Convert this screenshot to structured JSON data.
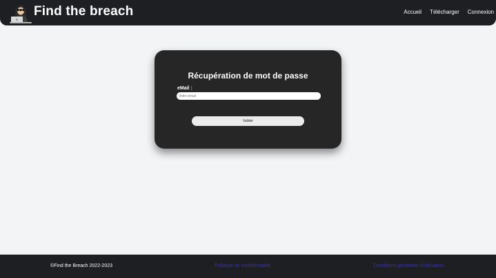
{
  "header": {
    "logo_icon": "hacker-with-laptop-icon",
    "site_title": "Find the breach",
    "nav": {
      "home": "Accueil",
      "download": "Télécharger",
      "login": "Connexion"
    }
  },
  "form": {
    "title": "Récupération de mot de passe",
    "email_label": "eMail :",
    "email_placeholder": "Votre email",
    "email_value": "",
    "submit_label": "Valider"
  },
  "footer": {
    "copyright": "©Find the Breach 2022-2023",
    "privacy_link": "Politique de confidentialité",
    "terms_link": "Conditions générales d'utilisation"
  },
  "colors": {
    "header_bg": "#1e1f22",
    "card_bg": "#262626",
    "page_bg": "#f3f4f6",
    "footer_link": "#3a32a8"
  }
}
